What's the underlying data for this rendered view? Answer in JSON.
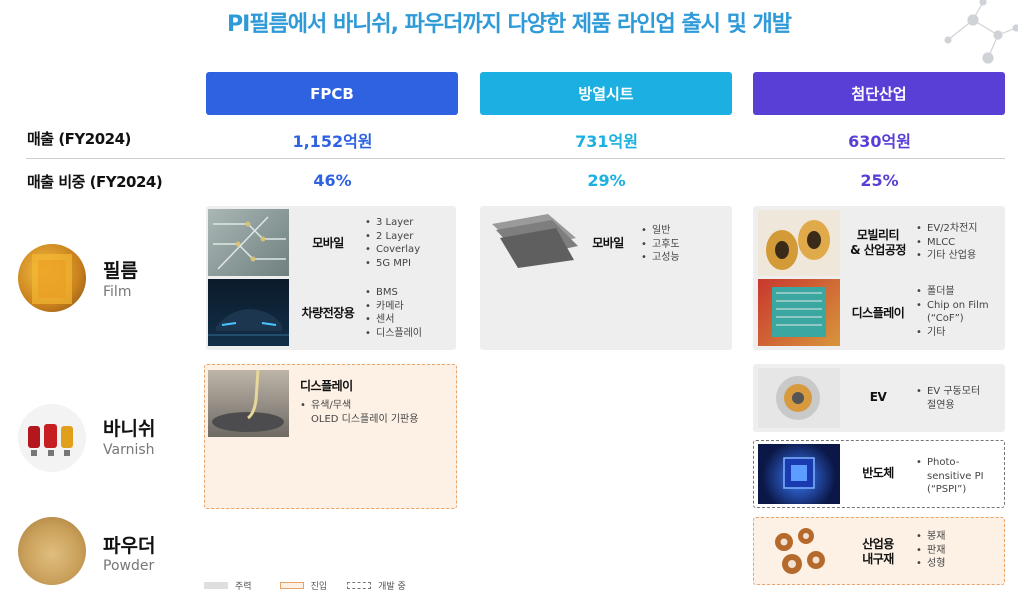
{
  "title": "PI필름에서 바니쉬, 파우더까지 다양한 제품 라인업 출시 및 개발",
  "columns": [
    {
      "name": "FPCB",
      "color": "#2f62e0",
      "revenue": "1,152억원",
      "share": "46%",
      "value_color": "#2f62e0"
    },
    {
      "name": "방열시트",
      "color": "#1cb0e2",
      "revenue": "731억원",
      "share": "29%",
      "value_color": "#1cb0e2"
    },
    {
      "name": "첨단산업",
      "color": "#5a3fd6",
      "revenue": "630억원",
      "share": "25%",
      "value_color": "#5a3fd6"
    }
  ],
  "rows": {
    "revenue_label": "매출 (FY2024)",
    "share_label": "매출 비중 (FY2024)"
  },
  "categories": [
    {
      "name": "필름",
      "sub": "Film"
    },
    {
      "name": "바니쉬",
      "sub": "Varnish"
    },
    {
      "name": "파우더",
      "sub": "Powder"
    }
  ],
  "film": {
    "fpcb": [
      {
        "label": "모바일",
        "bullets": [
          "3 Layer",
          "2 Layer",
          "Coverlay",
          "5G MPI"
        ]
      },
      {
        "label": "차량전장용",
        "bullets": [
          "BMS",
          "카메라",
          "센서",
          "디스플레이"
        ]
      }
    ],
    "heat": [
      {
        "label": "모바일",
        "bullets": [
          "일반",
          "고후도",
          "고성능"
        ]
      }
    ],
    "adv": [
      {
        "label": "모빌리티\n& 산업공정",
        "bullets": [
          "EV/2차전지",
          "MLCC",
          "기타 산업용"
        ]
      },
      {
        "label": "디스플레이",
        "bullets": [
          "폴더블",
          "Chip on Film\n(“CoF”)",
          "기타"
        ]
      }
    ]
  },
  "varnish": {
    "fpcb": {
      "label": "디스플레이",
      "bullets": [
        "유색/무색\nOLED 디스플레이 기판용"
      ]
    },
    "adv": [
      {
        "label": "EV",
        "bullets": [
          "EV 구동모터\n절연용"
        ]
      },
      {
        "label": "반도체",
        "bullets": [
          "Photo-\nsensitive PI\n(“PSPI”)"
        ]
      }
    ]
  },
  "powder": {
    "adv": {
      "label": "산업용\n내구재",
      "bullets": [
        "봉재",
        "판재",
        "성형"
      ]
    }
  },
  "legend": [
    {
      "label": "주력",
      "style": "gray"
    },
    {
      "label": "진입",
      "style": "orange"
    },
    {
      "label": "개발 중",
      "style": "dashed"
    }
  ]
}
